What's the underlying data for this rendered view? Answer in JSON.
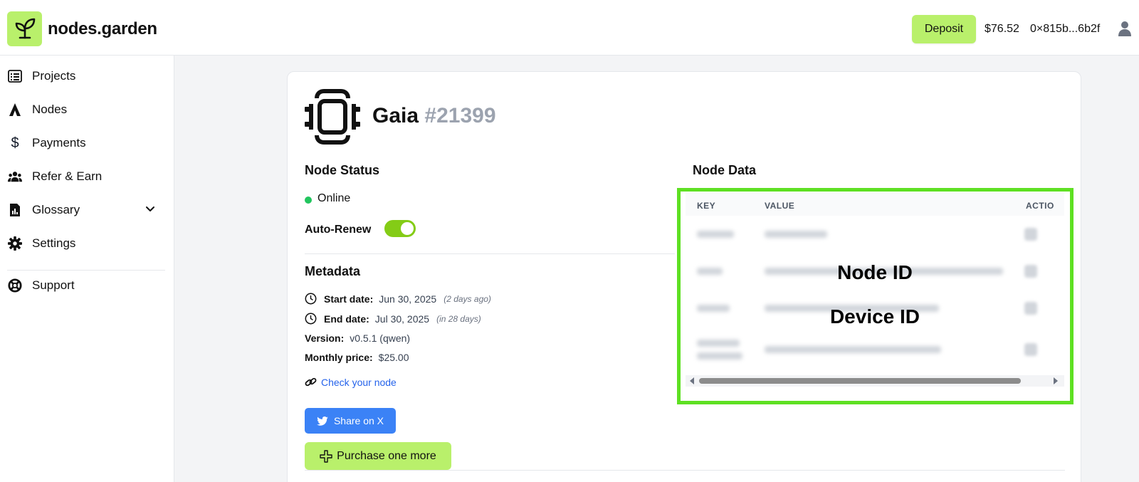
{
  "header": {
    "brand": "nodes.garden",
    "deposit_label": "Deposit",
    "balance": "$76.52",
    "wallet": "0×815b...6b2f"
  },
  "sidebar": {
    "items": [
      {
        "label": "Projects",
        "icon": "list-icon"
      },
      {
        "label": "Nodes",
        "icon": "nodes-icon"
      },
      {
        "label": "Payments",
        "icon": "dollar-icon"
      },
      {
        "label": "Refer & Earn",
        "icon": "users-icon"
      },
      {
        "label": "Glossary",
        "icon": "book-icon"
      },
      {
        "label": "Settings",
        "icon": "gear-icon"
      },
      {
        "label": "Support",
        "icon": "lifebuoy-icon"
      }
    ]
  },
  "node": {
    "name": "Gaia",
    "number": "#21399",
    "status_title": "Node Status",
    "status": "Online",
    "auto_renew_label": "Auto-Renew",
    "auto_renew_on": true,
    "metadata_title": "Metadata",
    "start_label": "Start date:",
    "start_value": "Jun 30, 2025",
    "start_rel": "(2 days ago)",
    "end_label": "End date:",
    "end_value": "Jul 30, 2025",
    "end_rel": "(in 28 days)",
    "version_label": "Version:",
    "version_value": "v0.5.1 (qwen)",
    "price_label": "Monthly price:",
    "price_value": "$25.00",
    "check_link": "Check your node",
    "share_label": "Share on X",
    "purchase_label": "Purchase one more"
  },
  "node_data": {
    "title": "Node Data",
    "columns": [
      "KEY",
      "VALUE",
      "ACTIO"
    ],
    "overlay_node_id": "Node ID",
    "overlay_device_id": "Device ID"
  },
  "colors": {
    "accent": "#b9f06b",
    "status_online": "#22c55e",
    "highlight": "#5ee022",
    "share": "#3b82f6"
  }
}
